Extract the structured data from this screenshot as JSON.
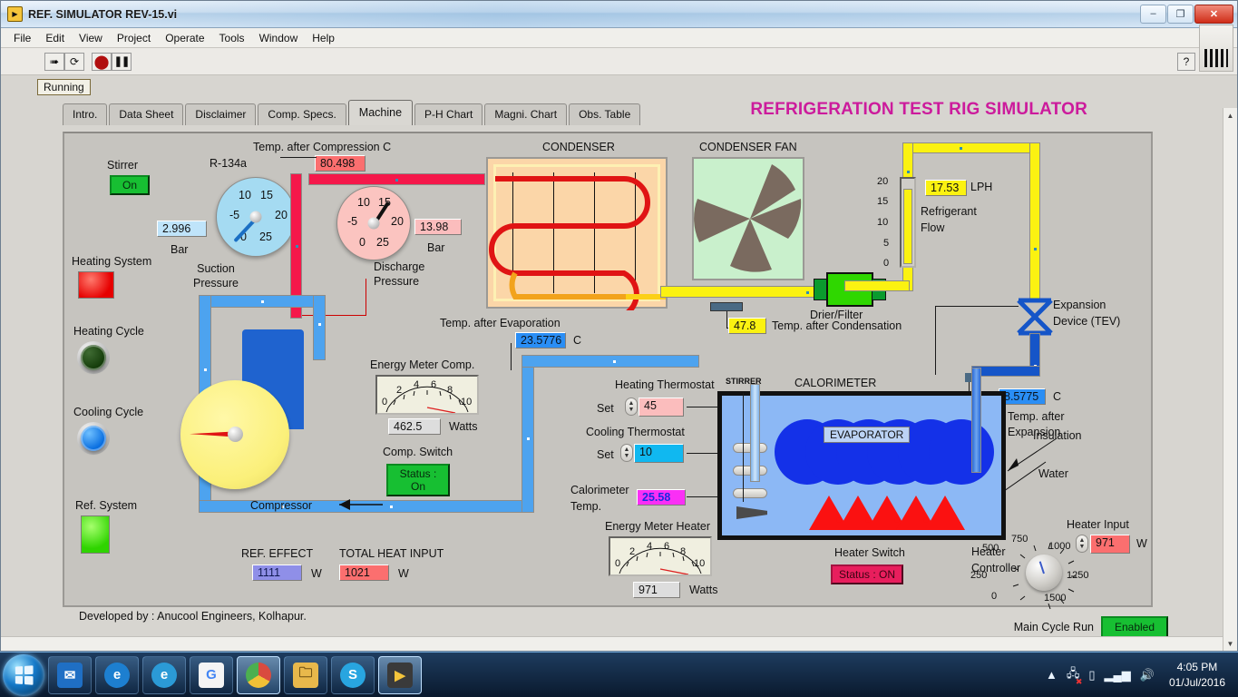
{
  "window": {
    "title": "REF. SIMULATOR REV-15.vi",
    "icon": "labview-vi-icon",
    "minimize": "–",
    "maximize": "❐",
    "close": "✕"
  },
  "menu": [
    "File",
    "Edit",
    "View",
    "Project",
    "Operate",
    "Tools",
    "Window",
    "Help"
  ],
  "toolbar": {
    "run": "run-arrow-icon",
    "run_continuously": "run-continuously-icon",
    "abort": "abort-stop-icon",
    "pause": "pause-icon",
    "help": "?"
  },
  "status": {
    "running_label": "Running"
  },
  "tabs": [
    {
      "label": "Intro.",
      "active": false
    },
    {
      "label": "Data Sheet",
      "active": false
    },
    {
      "label": "Disclaimer",
      "active": false
    },
    {
      "label": "Comp. Specs.",
      "active": false
    },
    {
      "label": "Machine",
      "active": true
    },
    {
      "label": "P-H Chart",
      "active": false
    },
    {
      "label": "Magni. Chart",
      "active": false
    },
    {
      "label": "Obs. Table",
      "active": false
    }
  ],
  "app_title": "REFRIGERATION TEST RIG SIMULATOR",
  "colors": {
    "title_accent": "#cc1b9c",
    "panel_bg": "#c6c4bf",
    "pipe_suction": "#4da3ef",
    "pipe_discharge": "#f5184a",
    "pipe_liquid": "#fbf211",
    "pipe_expansion": "#1555c8",
    "on_green": "#17bf32",
    "on_crimson": "#e81e5d"
  },
  "left_panel": {
    "stirrer": {
      "label": "Stirrer",
      "value": "On"
    },
    "heating_system": {
      "label": "Heating System",
      "state": "red"
    },
    "heating_cycle": {
      "label": "Heating Cycle",
      "state": "off-dark-green"
    },
    "cooling_cycle": {
      "label": "Cooling Cycle",
      "state": "on-blue"
    },
    "ref_system": {
      "label": "Ref. System",
      "state": "green"
    }
  },
  "refrigerant": {
    "label": "R-134a"
  },
  "suction": {
    "title_line1": "Suction",
    "title_line2": "Pressure",
    "value": "2.996",
    "unit": "Bar",
    "ticks": [
      "-5",
      "10",
      "15",
      "20",
      "0",
      "25"
    ],
    "scale_min": 0,
    "scale_max": 30,
    "reading": 2.996
  },
  "discharge": {
    "title_line1": "Discharge",
    "title_line2": "Pressure",
    "value": "13.98",
    "unit": "Bar",
    "ticks": [
      "-5",
      "10",
      "15",
      "20",
      "0",
      "25"
    ],
    "scale_min": 0,
    "scale_max": 30,
    "reading": 13.98
  },
  "temp_after_compression": {
    "label": "Temp. after Compression  C",
    "value": "80.498"
  },
  "condenser": {
    "label": "CONDENSER"
  },
  "condenser_fan": {
    "label": "CONDENSER FAN"
  },
  "drier_filter": {
    "label": "Drier/Filter"
  },
  "temp_after_condensation": {
    "label": "Temp. after Condensation",
    "value": "47.8"
  },
  "refrigerant_flow": {
    "label_line1": "Refrigerant",
    "label_line2": "Flow",
    "value": "17.53",
    "unit": "LPH",
    "ticks": [
      "20",
      "15",
      "10",
      "5",
      "0"
    ],
    "scale_min": 0,
    "scale_max": 20,
    "reading": 17.53
  },
  "expansion_device": {
    "label_line1": "Expansion",
    "label_line2": "Device (TEV)"
  },
  "temp_after_expansion": {
    "label_line1": "Temp. after",
    "label_line2": "Expansion",
    "value": "8.5775",
    "unit": "C"
  },
  "temp_after_evaporation": {
    "label": "Temp. after Evaporation",
    "value": "23.5776",
    "unit": "C"
  },
  "compressor": {
    "label": "Compressor"
  },
  "energy_meter_comp": {
    "label": "Energy Meter Comp.",
    "value": "462.5",
    "unit": "Watts",
    "ticks": [
      "0",
      "2",
      "4",
      "6",
      "8",
      "10"
    ],
    "scale_min": 0,
    "scale_max": 10,
    "reading": 9.6
  },
  "comp_switch": {
    "label": "Comp. Switch",
    "value": "Status : On"
  },
  "ref_effect": {
    "label": "REF. EFFECT",
    "value": "1111",
    "unit": "W"
  },
  "total_heat_input": {
    "label": "TOTAL HEAT INPUT",
    "value": "1021",
    "unit": "W"
  },
  "heating_thermostat": {
    "label": "Heating Thermostat",
    "set_label": "Set",
    "value": "45"
  },
  "cooling_thermostat": {
    "label": "Cooling Thermostat",
    "set_label": "Set",
    "value": "10"
  },
  "calorimeter_temp": {
    "label_line1": "Calorimeter",
    "label_line2": "Temp.",
    "value": "25.58"
  },
  "energy_meter_heater": {
    "label": "Energy Meter Heater",
    "value": "971",
    "unit": "Watts",
    "ticks": [
      "0",
      "2",
      "4",
      "6",
      "8",
      "10"
    ],
    "scale_min": 0,
    "scale_max": 10,
    "reading": 9.6
  },
  "calorimeter": {
    "label": "CALORIMETER",
    "stirrer_label": "STIRRER",
    "evaporator_label": "EVAPORATOR"
  },
  "heater_switch": {
    "label": "Heater Switch",
    "value": "Status : ON"
  },
  "heater_controller": {
    "label_line1": "Heater",
    "label_line2": "Controller",
    "ticks": [
      "0",
      "250",
      "500",
      "750",
      "1000",
      "1250",
      "1500"
    ],
    "scale_min": 0,
    "scale_max": 1500,
    "reading": 971
  },
  "heater_input": {
    "label": "Heater Input",
    "value": "971",
    "unit": "W"
  },
  "insulation": {
    "label": "Insulation"
  },
  "water": {
    "label": "Water"
  },
  "footer": {
    "developed_by": "Developed by : Anucool Engineers, Kolhapur."
  },
  "main_cycle_run": {
    "label": "Main Cycle Run",
    "value": "Enabled"
  },
  "taskbar": {
    "start": "windows-start-orb",
    "items": [
      {
        "name": "mail-icon",
        "glyph": "✉",
        "bg": "#1f6fc4",
        "active": false
      },
      {
        "name": "internet-explorer-icon",
        "glyph": "e",
        "bg": "#1d7fd0",
        "active": false
      },
      {
        "name": "browser-icon",
        "glyph": "e",
        "bg": "#2b9ad6",
        "active": false
      },
      {
        "name": "google-icon",
        "glyph": "G",
        "bg": "#4285f4",
        "active": false
      },
      {
        "name": "chrome-icon",
        "glyph": "◉",
        "bg": "#d94b3f",
        "active": true
      },
      {
        "name": "file-explorer-icon",
        "glyph": "🗀",
        "bg": "#e8b84b",
        "active": false
      },
      {
        "name": "skype-icon",
        "glyph": "S",
        "bg": "#28a5e0",
        "active": false
      },
      {
        "name": "labview-icon",
        "glyph": "▶",
        "bg": "#f5c53b",
        "active": true
      }
    ],
    "tray": [
      {
        "name": "show-hidden-icons",
        "glyph": "▲"
      },
      {
        "name": "network-error-icon",
        "glyph": "🖧"
      },
      {
        "name": "battery-icon",
        "glyph": "▯"
      },
      {
        "name": "signal-icon",
        "glyph": "▂▄▆"
      },
      {
        "name": "volume-icon",
        "glyph": "🔊"
      }
    ],
    "clock": {
      "time": "4:05 PM",
      "date": "01/Jul/2016"
    }
  }
}
